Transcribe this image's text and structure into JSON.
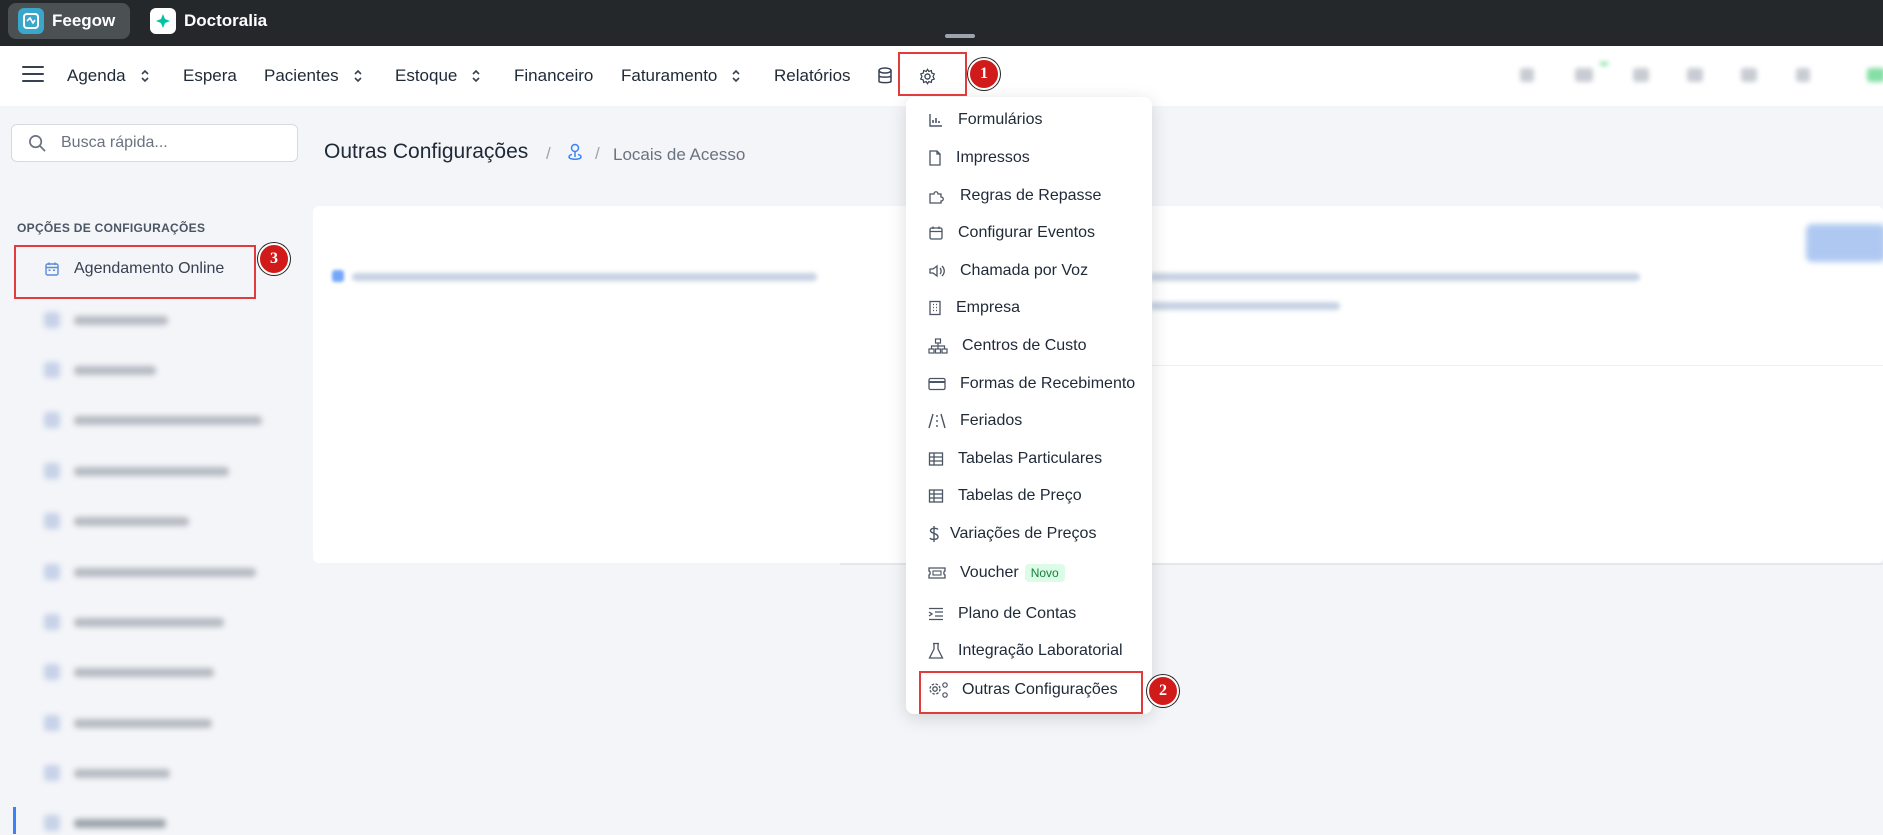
{
  "app_tabs": [
    {
      "label": "Feegow",
      "active": true,
      "icon": "feegow-logo-icon",
      "color": "#3aa6c9"
    },
    {
      "label": "Doctoralia",
      "active": false,
      "icon": "doctoralia-logo-icon",
      "color": "#00c3a5"
    }
  ],
  "nav": {
    "items": [
      {
        "label": "Agenda",
        "has_chevrons": true
      },
      {
        "label": "Espera",
        "has_chevrons": false
      },
      {
        "label": "Pacientes",
        "has_chevrons": true
      },
      {
        "label": "Estoque",
        "has_chevrons": true
      },
      {
        "label": "Financeiro",
        "has_chevrons": false
      },
      {
        "label": "Faturamento",
        "has_chevrons": true
      },
      {
        "label": "Relatórios",
        "has_chevrons": false
      }
    ],
    "icons": [
      "menu-icon",
      "database-icon",
      "gear-icon"
    ]
  },
  "sidebar": {
    "search_placeholder": "Busca rápida...",
    "section_title": "OPÇÕES DE CONFIGURAÇÕES",
    "items": [
      {
        "label": "Agendamento Online"
      }
    ]
  },
  "main": {
    "page_title": "Outras Configurações",
    "breadcrumb": [
      "Locais de Acesso"
    ]
  },
  "settings_menu": {
    "items": [
      {
        "label": "Formulários",
        "icon": "bar-chart-icon"
      },
      {
        "label": "Impressos",
        "icon": "document-icon"
      },
      {
        "label": "Regras de Repasse",
        "icon": "puzzle-icon"
      },
      {
        "label": "Configurar Eventos",
        "icon": "calendar-icon"
      },
      {
        "label": "Chamada por Voz",
        "icon": "speaker-icon"
      },
      {
        "label": "Empresa",
        "icon": "building-icon"
      },
      {
        "label": "Centros de Custo",
        "icon": "sitemap-icon"
      },
      {
        "label": "Formas de Recebimento",
        "icon": "credit-card-icon"
      },
      {
        "label": "Feriados",
        "icon": "road-icon"
      },
      {
        "label": "Tabelas Particulares",
        "icon": "table-icon"
      },
      {
        "label": "Tabelas de Preço",
        "icon": "table-icon"
      },
      {
        "label": "Variações de Preços",
        "icon": "dollar-icon"
      },
      {
        "label": "Voucher",
        "icon": "ticket-icon",
        "badge": "Novo"
      },
      {
        "label": "Plano de Contas",
        "icon": "indent-list-icon"
      },
      {
        "label": "Integração Laboratorial",
        "icon": "flask-icon"
      },
      {
        "label": "Outras Configurações",
        "icon": "gears-icon"
      }
    ]
  },
  "annotations": [
    "1",
    "2",
    "3"
  ],
  "colors": {
    "topbar": "#24282a",
    "annotation_red": "#d11a1a",
    "accent_blue": "#3b82f6"
  }
}
